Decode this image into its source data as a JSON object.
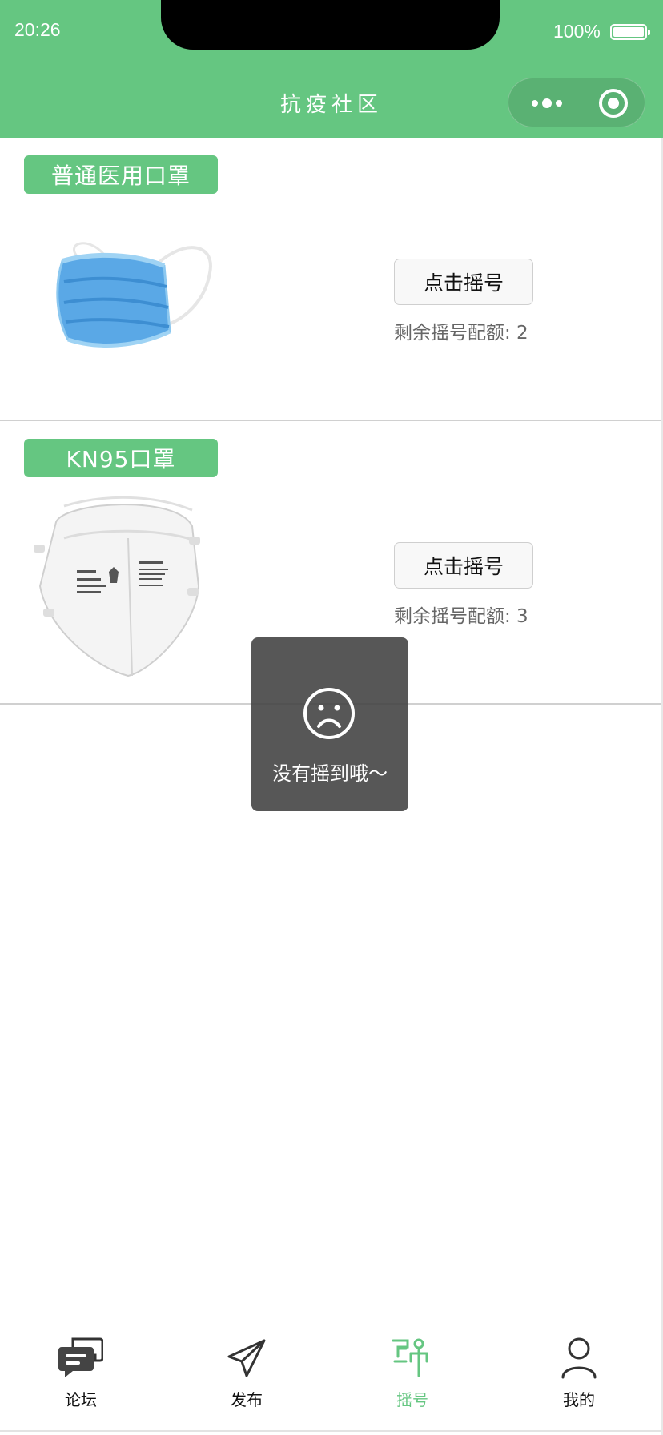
{
  "status_bar": {
    "time": "20:26",
    "battery_percent": "100%",
    "battery_level": 1.0
  },
  "nav_bar": {
    "title": "抗疫社区",
    "background_color": "#65c681",
    "capsule_more_icon": "more-dots-icon",
    "capsule_close_icon": "target-circle-icon"
  },
  "products": [
    {
      "tag": "普通医用口罩",
      "image": "surgical-mask-image",
      "button_label": "点击摇号",
      "quota_label": "剩余摇号配额: 2"
    },
    {
      "tag": "KN95口罩",
      "image": "kn95-mask-image",
      "button_label": "点击摇号",
      "quota_label": "剩余摇号配额: 3"
    }
  ],
  "toast": {
    "icon": "sad-face-icon",
    "message": "没有摇到哦～"
  },
  "tab_bar": {
    "active_color": "#65c681",
    "tabs": [
      {
        "label": "论坛",
        "icon": "chat-bubbles-icon",
        "active": false
      },
      {
        "label": "发布",
        "icon": "paper-plane-icon",
        "active": false
      },
      {
        "label": "摇号",
        "icon": "lottery-person-icon",
        "active": true
      },
      {
        "label": "我的",
        "icon": "person-icon",
        "active": false
      }
    ]
  }
}
